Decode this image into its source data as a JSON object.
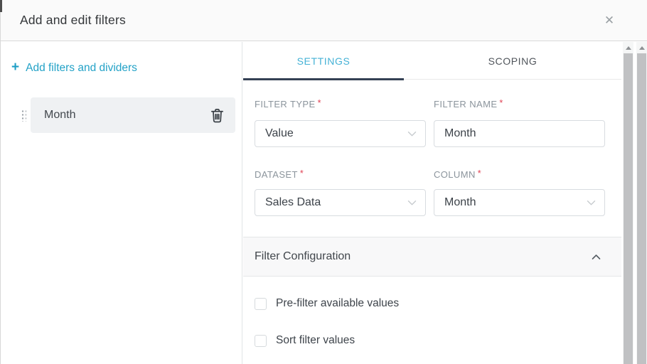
{
  "modal": {
    "title": "Add and edit filters",
    "close_icon": "✕"
  },
  "left_panel": {
    "add_icon": "+",
    "add_label": "Add filters and dividers",
    "filters": [
      {
        "name": "Month"
      }
    ]
  },
  "tabs": [
    {
      "label": "SETTINGS",
      "active": true
    },
    {
      "label": "SCOPING",
      "active": false
    }
  ],
  "form": {
    "required_mark": "*",
    "fields": [
      {
        "label": "FILTER TYPE",
        "required": true,
        "control": "select",
        "value": "Value"
      },
      {
        "label": "FILTER NAME",
        "required": true,
        "control": "text",
        "value": "Month"
      },
      {
        "label": "DATASET",
        "required": true,
        "control": "select",
        "value": "Sales Data"
      },
      {
        "label": "COLUMN",
        "required": true,
        "control": "select",
        "value": "Month"
      }
    ],
    "section_title": "Filter Configuration",
    "checkboxes": [
      {
        "label": "Pre-filter available values",
        "checked": false
      },
      {
        "label": "Sort filter values",
        "checked": false
      }
    ]
  },
  "colors": {
    "accent": "#20a7c9",
    "tab_active_text": "#45b2d6",
    "tab_indicator": "#344054",
    "required_asterisk": "#e04355",
    "header_bg": "#fafafa",
    "filter_item_bg": "#eff1f3",
    "section_bg": "#f8f8f9"
  }
}
